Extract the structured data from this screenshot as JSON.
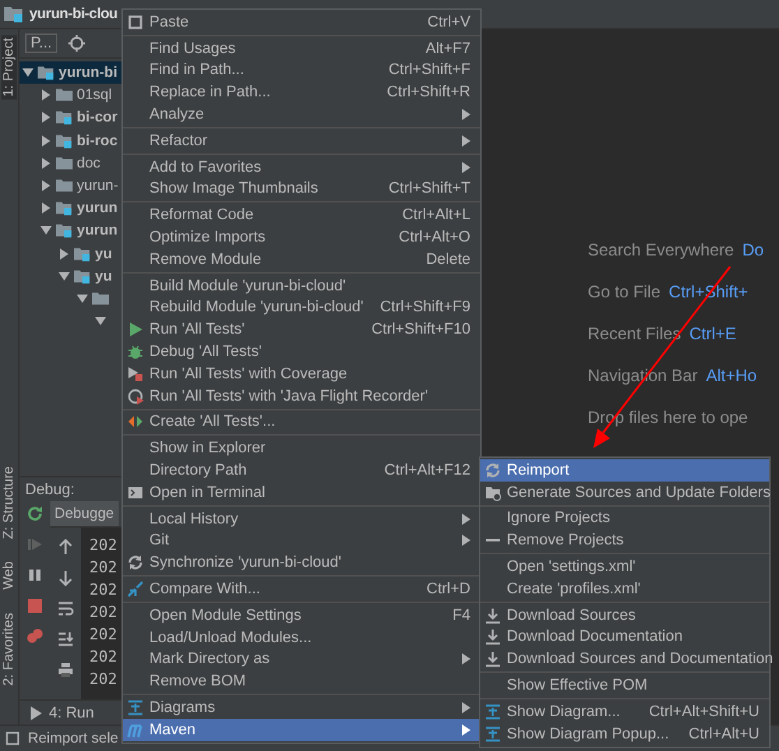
{
  "window": {
    "title": "yurun-bi-clou"
  },
  "tool_stripe": [
    {
      "label": "1: Project",
      "selected": true
    },
    {
      "label": "Z: Structure",
      "selected": false
    },
    {
      "label": "Web",
      "selected": false
    },
    {
      "label": "2: Favorites",
      "selected": false
    }
  ],
  "project_panel": {
    "view_selector": "P...",
    "tree": [
      {
        "label": "yurun-bi",
        "kind": "module",
        "expanded": true,
        "selected": true,
        "children": [
          {
            "label": "01sql",
            "kind": "folder",
            "expanded": false,
            "selected": false
          },
          {
            "label": "bi-cor",
            "kind": "module",
            "expanded": false,
            "selected": false
          },
          {
            "label": "bi-roc",
            "kind": "module",
            "expanded": false,
            "selected": false
          },
          {
            "label": "doc",
            "kind": "folder",
            "expanded": false,
            "selected": false
          },
          {
            "label": "yurun-",
            "kind": "folder",
            "expanded": false,
            "selected": false
          },
          {
            "label": "yurun",
            "kind": "module",
            "expanded": false,
            "selected": false
          },
          {
            "label": "yurun",
            "kind": "module",
            "expanded": true,
            "selected": false,
            "children": [
              {
                "label": "yu",
                "kind": "module",
                "expanded": false,
                "selected": false
              },
              {
                "label": "yu",
                "kind": "module",
                "expanded": true,
                "selected": false,
                "children": [
                  {
                    "kind": "folder",
                    "expanded": true,
                    "selected": false,
                    "children": [
                      {
                        "expanded": true,
                        "selected": false
                      }
                    ]
                  }
                ]
              }
            ]
          }
        ]
      }
    ]
  },
  "debug_panel": {
    "title": "Debug:",
    "tabs": [
      {
        "label": "Debugge",
        "selected": true
      }
    ],
    "log_lines": [
      "202",
      "202",
      "202",
      "202",
      "202",
      "202",
      "202"
    ]
  },
  "bottom_tabs": [
    {
      "label": "4: Run",
      "selected": false
    }
  ],
  "status_bar": {
    "text": "Reimport sele"
  },
  "welcome_hints": [
    {
      "label": "Search Everywhere",
      "shortcut": "Do"
    },
    {
      "label": "Go to File",
      "shortcut": "Ctrl+Shift+"
    },
    {
      "label": "Recent Files",
      "shortcut": "Ctrl+E"
    },
    {
      "label": "Navigation Bar",
      "shortcut": "Alt+Ho"
    },
    {
      "label": "Drop files here to ope"
    }
  ],
  "context_menu": {
    "groups": [
      [
        {
          "label": "Paste",
          "shortcut": "Ctrl+V",
          "submenu": false,
          "selected": false
        }
      ],
      [
        {
          "label": "Find Usages",
          "shortcut": "Alt+F7",
          "submenu": false,
          "selected": false
        },
        {
          "label": "Find in Path...",
          "shortcut": "Ctrl+Shift+F",
          "submenu": false,
          "selected": false
        },
        {
          "label": "Replace in Path...",
          "shortcut": "Ctrl+Shift+R",
          "submenu": false,
          "selected": false
        },
        {
          "label": "Analyze",
          "submenu": true,
          "selected": false
        }
      ],
      [
        {
          "label": "Refactor",
          "submenu": true,
          "selected": false
        }
      ],
      [
        {
          "label": "Add to Favorites",
          "submenu": true,
          "selected": false
        },
        {
          "label": "Show Image Thumbnails",
          "shortcut": "Ctrl+Shift+T",
          "submenu": false,
          "selected": false
        }
      ],
      [
        {
          "label": "Reformat Code",
          "shortcut": "Ctrl+Alt+L",
          "submenu": false,
          "selected": false
        },
        {
          "label": "Optimize Imports",
          "shortcut": "Ctrl+Alt+O",
          "submenu": false,
          "selected": false
        },
        {
          "label": "Remove Module",
          "shortcut": "Delete",
          "submenu": false,
          "selected": false
        }
      ],
      [
        {
          "label": "Build Module 'yurun-bi-cloud'",
          "submenu": false,
          "selected": false
        },
        {
          "label": "Rebuild Module 'yurun-bi-cloud'",
          "shortcut": "Ctrl+Shift+F9",
          "submenu": false,
          "selected": false
        },
        {
          "label": "Run 'All Tests'",
          "shortcut": "Ctrl+Shift+F10",
          "submenu": false,
          "selected": false
        },
        {
          "label": "Debug 'All Tests'",
          "submenu": false,
          "selected": false
        },
        {
          "label": "Run 'All Tests' with Coverage",
          "submenu": false,
          "selected": false
        },
        {
          "label": "Run 'All Tests' with 'Java Flight Recorder'",
          "submenu": false,
          "selected": false
        }
      ],
      [
        {
          "label": "Create 'All Tests'...",
          "submenu": false,
          "selected": false
        }
      ],
      [
        {
          "label": "Show in Explorer",
          "submenu": false,
          "selected": false
        },
        {
          "label": "Directory Path",
          "shortcut": "Ctrl+Alt+F12",
          "submenu": false,
          "selected": false
        },
        {
          "label": "Open in Terminal",
          "submenu": false,
          "selected": false
        }
      ],
      [
        {
          "label": "Local History",
          "submenu": true,
          "selected": false
        },
        {
          "label": "Git",
          "submenu": true,
          "selected": false
        },
        {
          "label": "Synchronize 'yurun-bi-cloud'",
          "submenu": false,
          "selected": false
        }
      ],
      [
        {
          "label": "Compare With...",
          "shortcut": "Ctrl+D",
          "submenu": false,
          "selected": false
        }
      ],
      [
        {
          "label": "Open Module Settings",
          "shortcut": "F4",
          "submenu": false,
          "selected": false
        },
        {
          "label": "Load/Unload Modules...",
          "submenu": false,
          "selected": false
        },
        {
          "label": "Mark Directory as",
          "submenu": true,
          "selected": false
        },
        {
          "label": "Remove BOM",
          "submenu": false,
          "selected": false
        }
      ],
      [
        {
          "label": "Diagrams",
          "submenu": true,
          "selected": false
        },
        {
          "label": "Maven",
          "submenu": true,
          "selected": true
        }
      ]
    ]
  },
  "maven_submenu": {
    "groups": [
      [
        {
          "label": "Reimport",
          "selected": true
        },
        {
          "label": "Generate Sources and Update Folders",
          "selected": false
        }
      ],
      [
        {
          "label": "Ignore Projects",
          "selected": false
        },
        {
          "label": "Remove Projects",
          "selected": false
        }
      ],
      [
        {
          "label": "Open 'settings.xml'",
          "selected": false
        },
        {
          "label": "Create 'profiles.xml'",
          "selected": false
        }
      ],
      [
        {
          "label": "Download Sources",
          "selected": false
        },
        {
          "label": "Download Documentation",
          "selected": false
        },
        {
          "label": "Download Sources and Documentation",
          "selected": false
        }
      ],
      [
        {
          "label": "Show Effective POM",
          "selected": false
        }
      ],
      [
        {
          "label": "Show Diagram...",
          "shortcut": "Ctrl+Alt+Shift+U",
          "selected": false
        },
        {
          "label": "Show Diagram Popup...",
          "shortcut": "Ctrl+Alt+U",
          "selected": false
        }
      ]
    ]
  }
}
